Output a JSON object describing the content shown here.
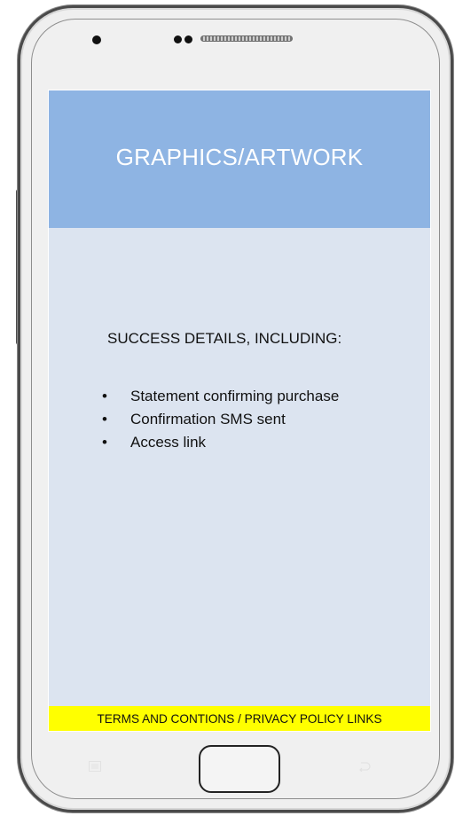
{
  "screen": {
    "header": {
      "title": "GRAPHICS/ARTWORK",
      "background_color": "#8EB4E3"
    },
    "details": {
      "heading": "SUCCESS DETAILS, INCLUDING:",
      "items": [
        "Statement confirming purchase",
        "Confirmation SMS sent",
        "Access link"
      ]
    },
    "footer": {
      "links_text": "TERMS AND CONTIONS / PRIVACY POLICY LINKS",
      "background_color": "#FFFF00"
    },
    "background_color": "#DCE4F0"
  },
  "device": {
    "icons": [
      "front-camera-icon",
      "sensor-icon",
      "speaker-grille-icon",
      "menu-icon",
      "back-icon"
    ]
  }
}
